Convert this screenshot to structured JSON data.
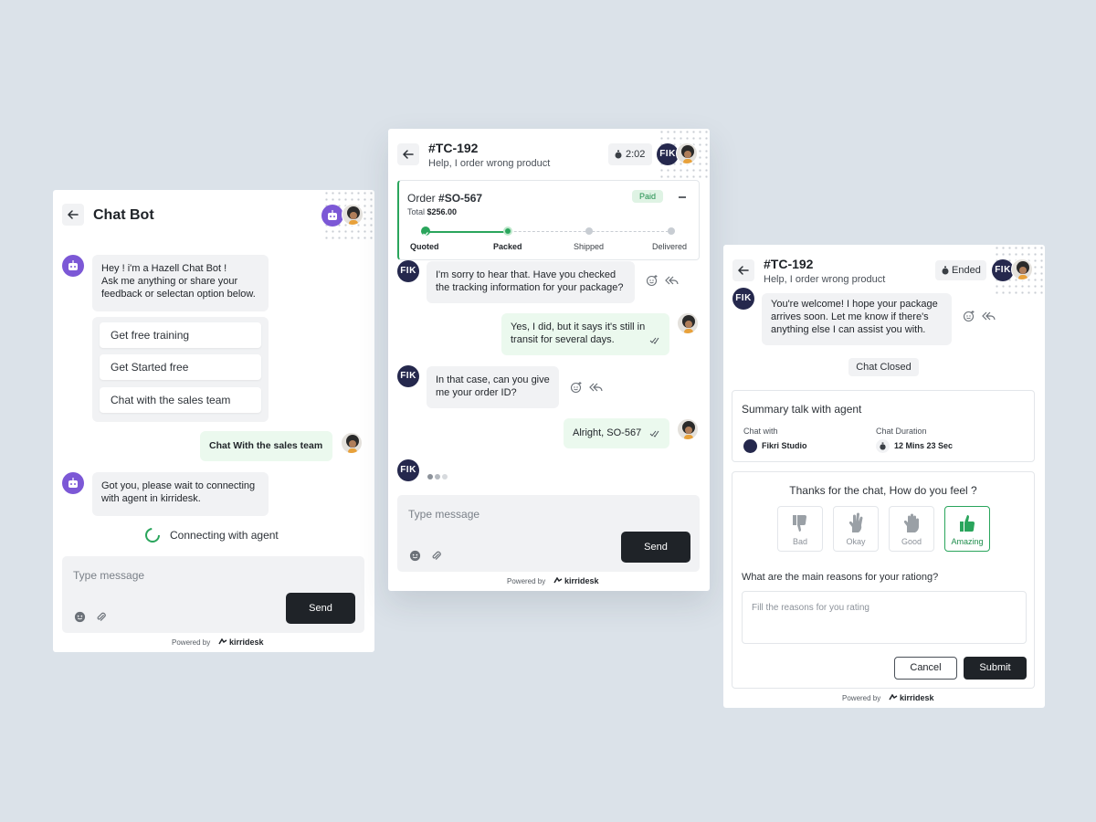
{
  "colors": {
    "accent_green": "#2aa55c",
    "bot_purple": "#7c58d6",
    "dark": "#1f2328",
    "agent_navy": "#25284d"
  },
  "chatbot": {
    "title": "Chat Bot",
    "bot_greeting": [
      "Hey ! i'm a Hazell Chat Bot !",
      "Ask me anything or share your",
      "feedback or selectan option below."
    ],
    "options": [
      "Get free training",
      "Get Started free",
      "Chat with the sales team"
    ],
    "user_message": "Chat With the sales team",
    "bot_reply": [
      "Got you, please wait to connecting",
      "with agent in kirridesk."
    ],
    "connecting_text": "Connecting with agent",
    "composer_placeholder": "Type message",
    "send_label": "Send",
    "powered_by": "Powered by",
    "brand": "kirridesk"
  },
  "ticket": {
    "title": "#TC-192",
    "subtitle": "Help, I order wrong product",
    "timer": "2:02",
    "agent_initials": "FIK",
    "order_prefix": "Order ",
    "order_id": "#SO-567",
    "total_label": "Total",
    "total_value": "$256.00",
    "status_badge": "Paid",
    "steps": [
      {
        "label": "Quoted",
        "state": "done"
      },
      {
        "label": "Packed",
        "state": "current"
      },
      {
        "label": "Shipped",
        "state": "pending"
      },
      {
        "label": "Delivered",
        "state": "pending"
      }
    ],
    "progress": 0.5,
    "messages": [
      {
        "from": "agent",
        "lines": [
          "I'm sorry to hear that. Have you checked",
          "the tracking information for your package?"
        ]
      },
      {
        "from": "user",
        "lines": [
          "Yes, I did, but it says it's still in",
          "transit for several days."
        ]
      },
      {
        "from": "agent",
        "lines": [
          "In that case, can you give",
          "me your order ID?"
        ]
      },
      {
        "from": "user",
        "lines": [
          "Alright, SO-567"
        ]
      }
    ],
    "composer_placeholder": "Type message",
    "send_label": "Send",
    "powered_by": "Powered by",
    "brand": "kirridesk"
  },
  "closed": {
    "title": "#TC-192",
    "subtitle": "Help, I order wrong product",
    "status": "Ended",
    "agent_initials": "FIK",
    "last_message": [
      "You're welcome! I hope your package",
      "arrives soon. Let me know if there's",
      "anything else I can assist you with."
    ],
    "chat_closed_label": "Chat Closed",
    "summary_title": "Summary talk with agent",
    "chat_with_label": "Chat with",
    "chat_with_value": "Fikri Studio",
    "duration_label": "Chat Duration",
    "duration_value": "12 Mins 23 Sec",
    "feel_question": "Thanks for the chat, How do you feel ?",
    "ratings": [
      {
        "label": "Bad",
        "icon": "thumbs-down-icon"
      },
      {
        "label": "Okay",
        "icon": "hand-okay-icon"
      },
      {
        "label": "Good",
        "icon": "hand-open-icon"
      },
      {
        "label": "Amazing",
        "icon": "thumbs-up-icon"
      }
    ],
    "selected_rating": "Amazing",
    "reasons_question": "What are the main reasons for your rationg?",
    "reasons_placeholder": "Fill the reasons for you rating",
    "cancel_label": "Cancel",
    "submit_label": "Submit",
    "powered_by": "Powered by",
    "brand": "kirridesk"
  }
}
